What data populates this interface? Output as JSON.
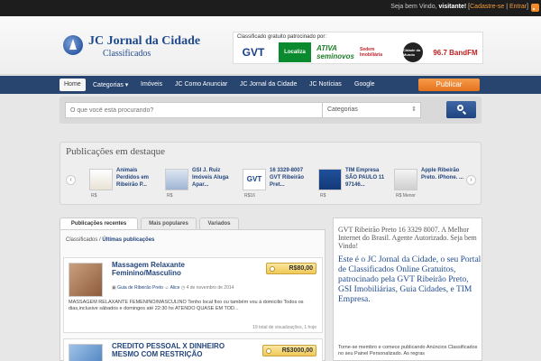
{
  "topbar": {
    "welcome": "Seja bem Vindo,",
    "user": "visitante!",
    "sep_open": " [",
    "register": "Cadastre-se",
    "sep_mid": " | ",
    "login": "Entrar",
    "sep_close": "]"
  },
  "header": {
    "logo_title": "JC Jornal da Cidade",
    "logo_subtitle": "Classificados",
    "sponsor_caption": "Classificado gratuito patrocinado por:",
    "sponsors": [
      "GVT",
      "Localiza",
      "ATIVA seminovos",
      "Sedem Imobiliária",
      "Cidade do Mundo",
      "96.7 BandFM"
    ]
  },
  "nav": {
    "items": [
      "Home",
      "Categorias",
      "Imóveis",
      "JC Como Anunciar",
      "JC Jornal da Cidade",
      "JC Notícias",
      "Google"
    ],
    "publish": "Publicar"
  },
  "search": {
    "placeholder": "O que você está procurando?",
    "category": "Categorias"
  },
  "featured": {
    "title": "Publicações em destaque",
    "items": [
      {
        "title": "Animais Perdidos em Ribeirão P...",
        "price": "R$"
      },
      {
        "title": "GSI J. Ruiz Imóveis Aluga Apar...",
        "price": "R$"
      },
      {
        "title": "16 3329-8007 GVT Ribeirão Pret...",
        "price": "R$16"
      },
      {
        "title": "TIM Empresa SÃO PAULO 11 97146...",
        "price": "R$"
      },
      {
        "title": "Apple Ribeirão Preto. iPhone. ...",
        "price": "R$ Menor"
      }
    ]
  },
  "tabs": [
    "Publicações recentes",
    "Mais populares",
    "Variados"
  ],
  "breadcrumb": {
    "root": "Classificados",
    "sep": " / ",
    "current": "Últimas publicações"
  },
  "listings": [
    {
      "title": "Massagem Relaxante Feminino/Masculino",
      "price": "R$80,00",
      "category": "Guia de Ribeirão Preto",
      "author": "Alice",
      "date": "4 de novembro de 2014",
      "description": "MASSAGEM RELAXANTE FEMENINO/MASCULINO Tenho local fixo ou também vou à domicilio Todos os dias,inclusive sábados e domingos até 22:30 hs ATENDO QUASE EM TOD...",
      "stats": "19 total de visualizações, 1 hoje"
    },
    {
      "title": "CREDITO PESSOAL X DINHEIRO MESMO COM RESTRIÇÃO",
      "price": "R$3000,00"
    }
  ],
  "sidebar": {
    "headline": "GVT Ribeirão Preto 16 3329 8007. A Melhor Internet do Brasil. Agente Autorizado. Seja bem Vindo!",
    "body": "Este é o JC Jornal da Cidade, o seu Portal de Classificados Online Gratuitos, patrocinado pela GVT Ribeirão Preto, GSI Imobiliárias, Guia Cidades, e TIM Empresa.",
    "footer": "Torne-se membro e comece publicando Anúncios Classificados no seu Painel Personalizado. As regras"
  },
  "colors": {
    "nav": "#28456f",
    "accent": "#e4711c",
    "link": "#23457d",
    "price_tag": "#f0c857"
  }
}
